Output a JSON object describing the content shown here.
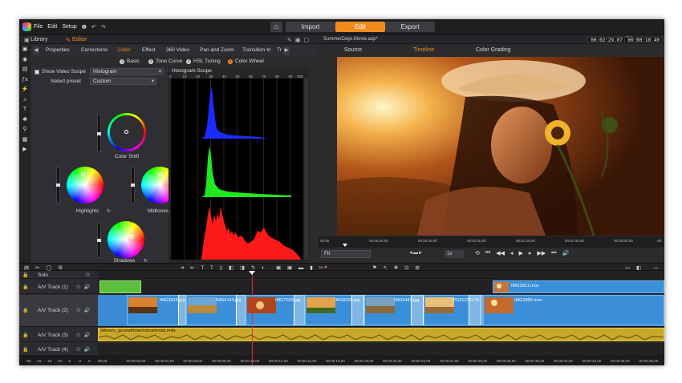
{
  "menu": {
    "file": "File",
    "edit": "Edit",
    "setup": "Setup",
    "help": "❶",
    "undo": "↶",
    "redo": "↷"
  },
  "modes": {
    "home": "⌂",
    "import": "Import",
    "edit": "Edit",
    "export": "Export",
    "active": "Edit"
  },
  "left_header": {
    "library": "Library",
    "editor": "Editor",
    "library_icon": "library-icon",
    "editor_icon": "editor-icon"
  },
  "project": {
    "filename": "SummerDays.Movie.axp*",
    "duration": "00:02:29.07",
    "tc_label": "TC",
    "timecode": "00:00:10.40"
  },
  "editor_tabs": [
    "Properties",
    "Corrections",
    "Color",
    "Effect",
    "360 Video",
    "Pan and Zoom",
    "Transition In",
    "Tr"
  ],
  "editor_active_tab": "Color",
  "color_subtabs": [
    {
      "num": "1",
      "label": "Basic"
    },
    {
      "num": "2",
      "label": "Tone Curve"
    },
    {
      "num": "3",
      "label": "HSL Tuning"
    },
    {
      "num": "4",
      "label": "Color Wheel"
    }
  ],
  "scope": {
    "show_label": "Show Video Scope",
    "scope_value": "Histogram",
    "preset_label": "Select preset",
    "preset_value": "Custom",
    "histogram_title": "Histogram Scope"
  },
  "histogram_ticks": [
    "0",
    "10",
    "20",
    "30",
    "40",
    "50",
    "60",
    "70",
    "80",
    "90",
    "100"
  ],
  "wheels": {
    "color_shift": "Color Shift",
    "highlights": "Highlights",
    "midtones": "Midtones",
    "shadows": "Shadows",
    "reset_icon": "reset-icon"
  },
  "preview_tabs": [
    "Source",
    "Timeline",
    "Color Grading"
  ],
  "preview_active_tab": "Timeline",
  "scrubber_ticks": [
    "00:00",
    "00:00:20,00",
    "00:00:40,00",
    "00:01:00,00",
    "00:01:20,00",
    "00:01:40,00",
    "00:02:00,00",
    "00:"
  ],
  "playback": {
    "fit": "Fit",
    "speed": "1x"
  },
  "tracks": [
    {
      "name": "Solo",
      "type": "solo"
    },
    {
      "name": "A/V Track (1)",
      "type": "video"
    },
    {
      "name": "A/V Track (2)",
      "type": "video"
    },
    {
      "name": "A/V Track (3)",
      "type": "audio"
    },
    {
      "name": "A/V Track (4)",
      "type": "empty"
    }
  ],
  "clips": [
    {
      "label": "IMG3916.jpg"
    },
    {
      "label": "IMG6143.jpg"
    },
    {
      "label": "IMG7032.jpg"
    },
    {
      "label": "IMG8268.jpg"
    },
    {
      "label": "IMG9443.jpg"
    },
    {
      "label": "PS21375174..."
    },
    {
      "label": "IMG2865.mov"
    },
    {
      "label": "IMG3351.mov"
    }
  ],
  "audio_clip": {
    "label": "Sthoory_growwithmeinstrumental.m4a"
  },
  "ruler_ticks": [
    "00:00",
    "00:00:02,00",
    "00:00:04,00",
    "00:00:06,00",
    "00:00:08,00",
    "00:00:10,00",
    "00:00:12,00",
    "00:00:14,00",
    "00:00:16,00",
    "00:00:18,00",
    "00:00:20,00",
    "00:00:22,00",
    "00:00:24,00",
    "00:00:26,00",
    "00:00:28,00",
    "00:00:30,00",
    "00:00:32,00",
    "00:00:34,00",
    "00:00:36,00",
    "00:00:38,00"
  ],
  "meter_ticks": [
    "-60",
    "-22",
    "-16",
    "-10",
    "-6",
    "-3",
    "0"
  ],
  "colors": {
    "accent": "#f28b1e",
    "clip_blue": "#3b8fd8",
    "audio_gold": "#c9a728",
    "playhead": "#e02e2e"
  }
}
